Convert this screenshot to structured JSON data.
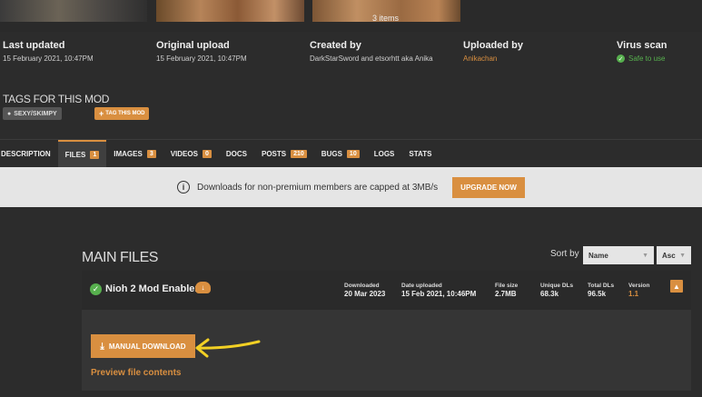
{
  "gallery": {
    "items_count": "3 items"
  },
  "meta": {
    "last_updated": {
      "label": "Last updated",
      "value": "15 February 2021,  10:47PM"
    },
    "original_upload": {
      "label": "Original upload",
      "value": "15 February 2021,  10:47PM"
    },
    "created_by": {
      "label": "Created by",
      "value": "DarkStarSword and etsorhtt aka Anika"
    },
    "uploaded_by": {
      "label": "Uploaded by",
      "value": "Anikachan"
    },
    "virus_scan": {
      "label": "Virus scan",
      "value": "Safe to use"
    }
  },
  "tags": {
    "title": "TAGS FOR THIS MOD",
    "items": [
      "SEXY/SKIMPY"
    ],
    "add_label": "TAG THIS MOD"
  },
  "tabs": [
    {
      "label": "DESCRIPTION"
    },
    {
      "label": "FILES",
      "badge": "1"
    },
    {
      "label": "IMAGES",
      "badge": "3"
    },
    {
      "label": "VIDEOS",
      "badge": "0"
    },
    {
      "label": "DOCS"
    },
    {
      "label": "POSTS",
      "badge": "210"
    },
    {
      "label": "BUGS",
      "badge": "10"
    },
    {
      "label": "LOGS"
    },
    {
      "label": "STATS"
    }
  ],
  "notice": {
    "text": "Downloads for non-premium members are capped at 3MB/s",
    "button": "UPGRADE NOW"
  },
  "files": {
    "section_title": "MAIN FILES",
    "sort_label": "Sort by",
    "sort_field": "Name",
    "sort_order": "Asc",
    "file": {
      "name": "Nioh 2 Mod Enabler",
      "stats": [
        {
          "label": "Downloaded",
          "value": "20 Mar 2023"
        },
        {
          "label": "Date uploaded",
          "value": "15 Feb 2021, 10:46PM"
        },
        {
          "label": "File size",
          "value": "2.7MB"
        },
        {
          "label": "Unique DLs",
          "value": "68.3k"
        },
        {
          "label": "Total DLs",
          "value": "96.5k"
        },
        {
          "label": "Version",
          "value": "1.1"
        }
      ],
      "manual_download": "MANUAL DOWNLOAD",
      "preview": "Preview file contents"
    }
  },
  "colors": {
    "accent": "#d98f40",
    "safe": "#57b04e",
    "annotation_arrow": "#f2d024"
  }
}
